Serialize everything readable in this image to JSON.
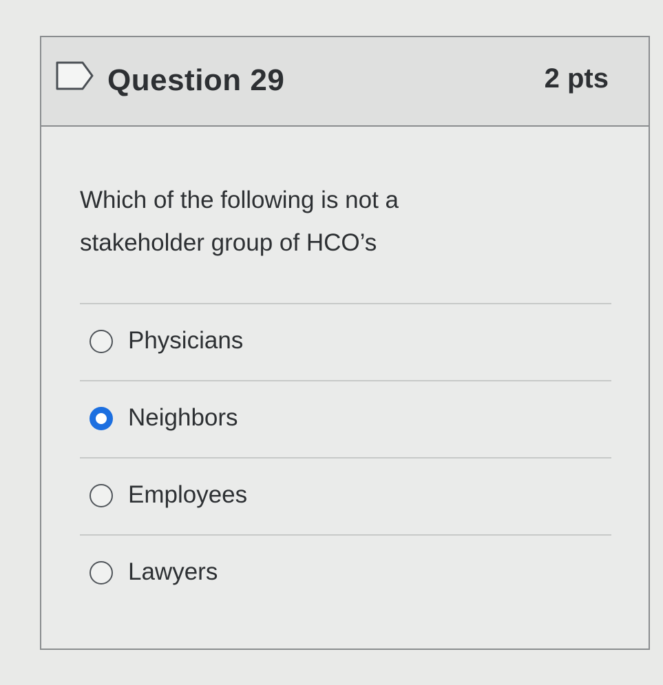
{
  "question": {
    "title": "Question 29",
    "points": "2 pts",
    "text": "Which of the following is not a stakeholder group of HCO’s",
    "flag_icon": "flag-outline-icon"
  },
  "answers": [
    {
      "label": "Physicians",
      "selected": false
    },
    {
      "label": "Neighbors",
      "selected": true
    },
    {
      "label": "Employees",
      "selected": false
    },
    {
      "label": "Lawyers",
      "selected": false
    }
  ],
  "colors": {
    "selected_radio": "#1c6fe0",
    "text": "#2d3033",
    "header_bg": "#dfe0df"
  }
}
